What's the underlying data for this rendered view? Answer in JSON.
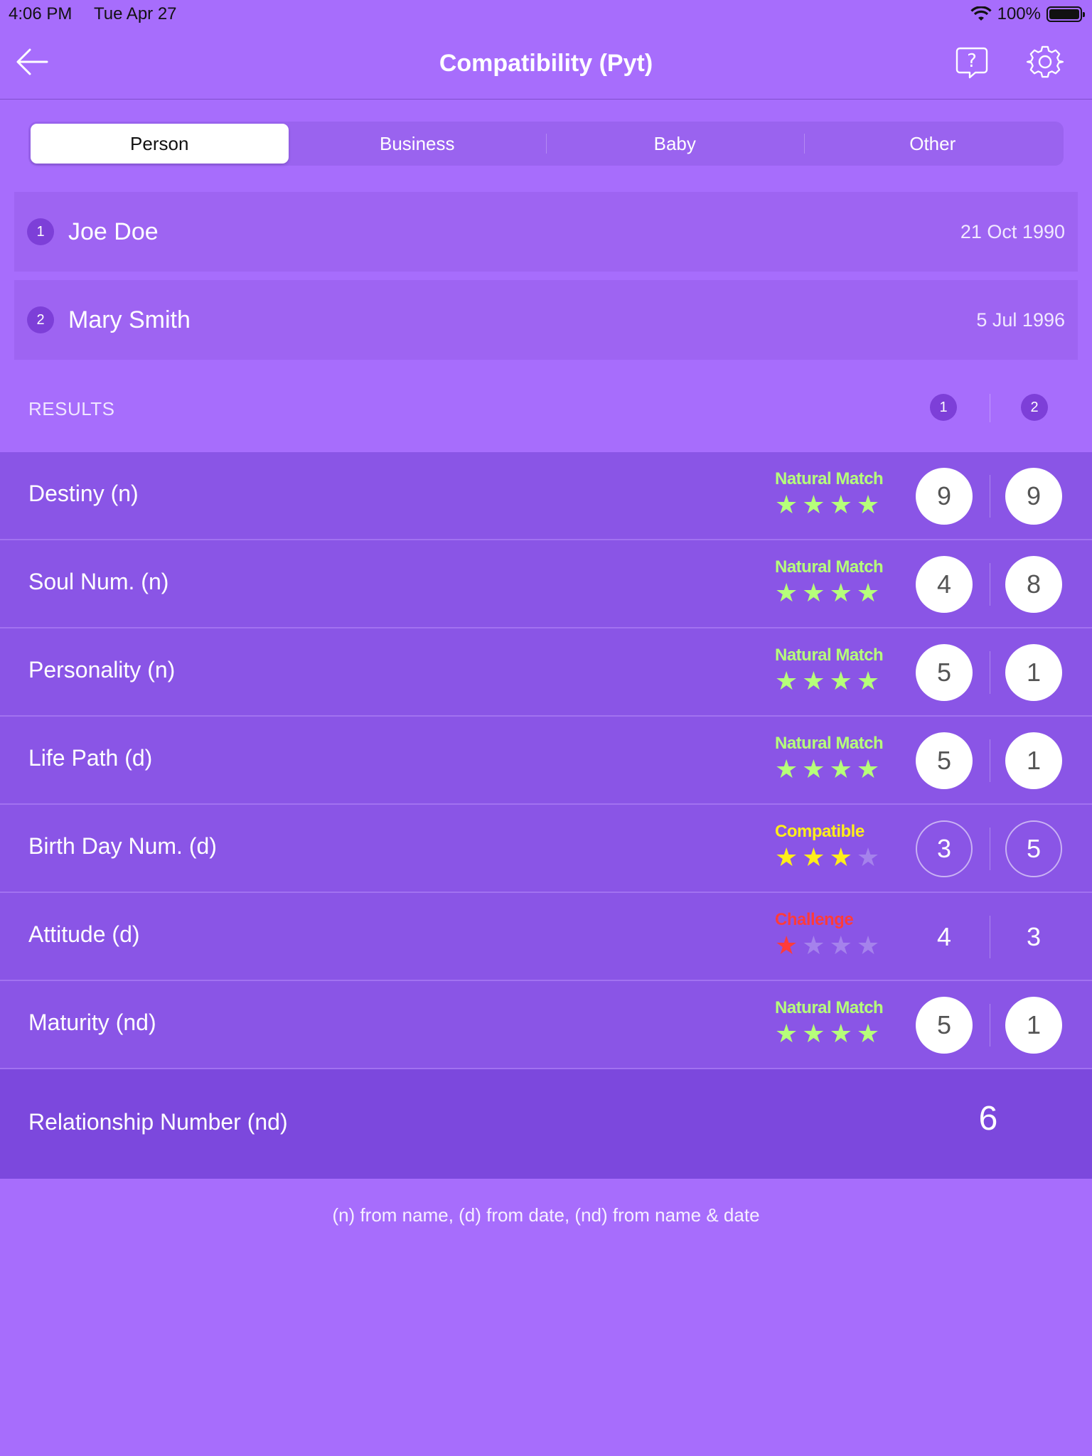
{
  "status_bar": {
    "time": "4:06 PM",
    "date": "Tue Apr 27",
    "battery": "100%"
  },
  "nav": {
    "title": "Compatibility (Pyt)"
  },
  "tabs": [
    {
      "label": "Person",
      "active": true
    },
    {
      "label": "Business",
      "active": false
    },
    {
      "label": "Baby",
      "active": false
    },
    {
      "label": "Other",
      "active": false
    }
  ],
  "people": [
    {
      "index": "1",
      "name": "Joe Doe",
      "date": "21 Oct 1990"
    },
    {
      "index": "2",
      "name": "Mary Smith",
      "date": "5 Jul 1996"
    }
  ],
  "results": {
    "header": "RESULTS",
    "col1": "1",
    "col2": "2",
    "rows": [
      {
        "label": "Destiny (n)",
        "rating": "Natural Match",
        "stars": 4,
        "color": "#b6ff7a",
        "v1": "9",
        "v2": "9",
        "style": "filled"
      },
      {
        "label": "Soul Num. (n)",
        "rating": "Natural Match",
        "stars": 4,
        "color": "#b6ff7a",
        "v1": "4",
        "v2": "8",
        "style": "filled"
      },
      {
        "label": "Personality (n)",
        "rating": "Natural Match",
        "stars": 4,
        "color": "#b6ff7a",
        "v1": "5",
        "v2": "1",
        "style": "filled"
      },
      {
        "label": "Life Path (d)",
        "rating": "Natural Match",
        "stars": 4,
        "color": "#b6ff7a",
        "v1": "5",
        "v2": "1",
        "style": "filled"
      },
      {
        "label": "Birth Day Num. (d)",
        "rating": "Compatible",
        "stars": 3,
        "color": "#ffee1a",
        "v1": "3",
        "v2": "5",
        "style": "outline"
      },
      {
        "label": "Attitude (d)",
        "rating": "Challenge",
        "stars": 1,
        "color": "#ff3b3b",
        "v1": "4",
        "v2": "3",
        "style": "plain"
      },
      {
        "label": "Maturity (nd)",
        "rating": "Natural Match",
        "stars": 4,
        "color": "#b6ff7a",
        "v1": "5",
        "v2": "1",
        "style": "filled"
      }
    ]
  },
  "relationship": {
    "label": "Relationship Number (nd)",
    "value": "6"
  },
  "footnote": "(n) from name, (d) from date, (nd) from name & date"
}
